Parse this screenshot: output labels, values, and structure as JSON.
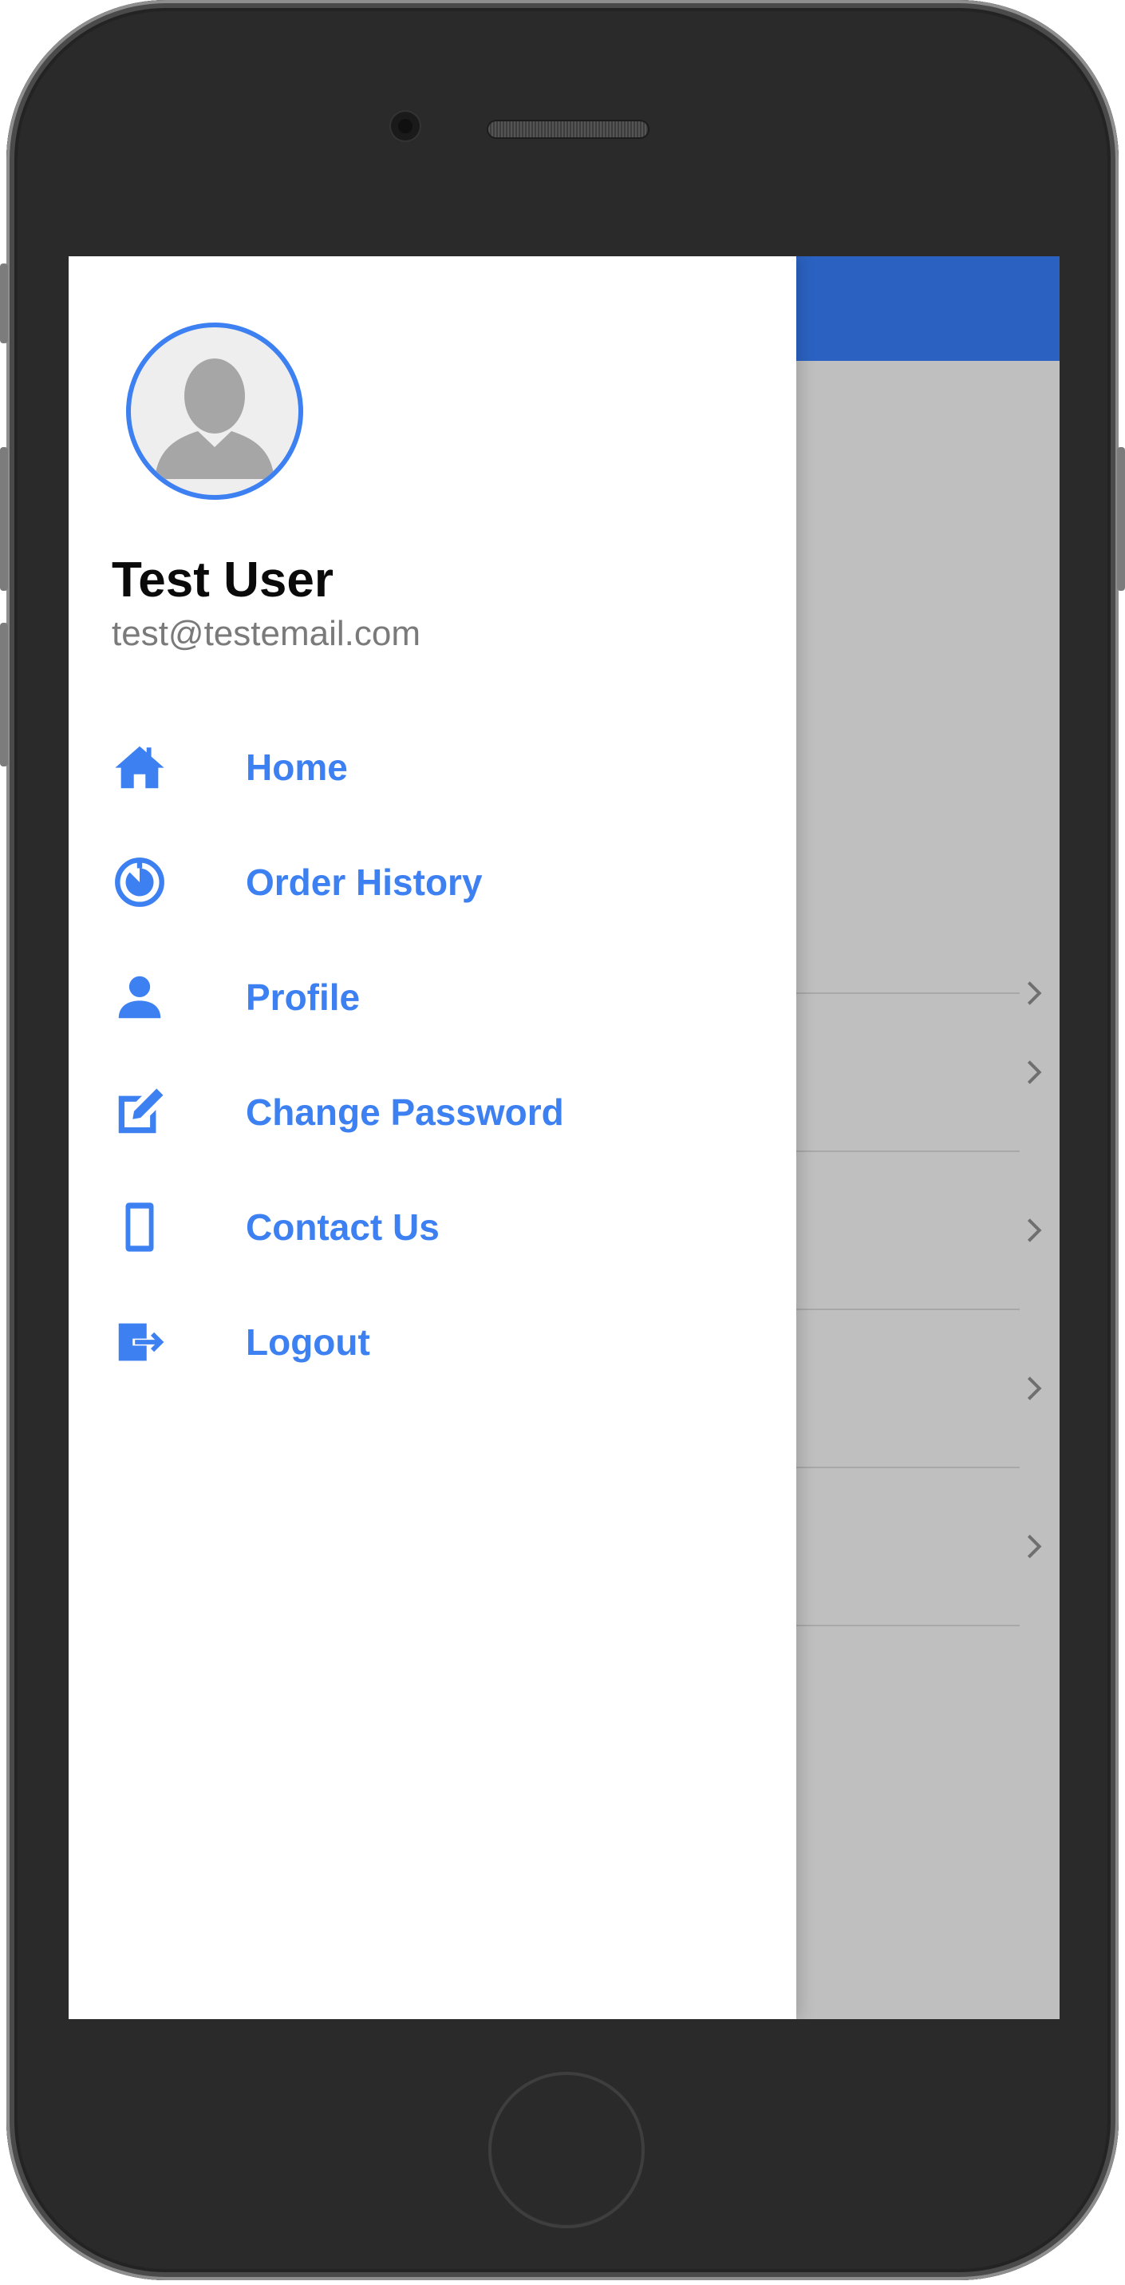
{
  "colors": {
    "accent": "#3d80f2",
    "app_bar": "#2b62c2",
    "scrim": "#bfbfbf",
    "user_name": "#0a0a0a",
    "email": "#7a7a7a"
  },
  "drawer": {
    "user": {
      "name": "Test User",
      "email": "test@testemail.com",
      "avatar_icon": "person-silhouette-icon"
    },
    "menu": [
      {
        "label": "Home",
        "icon": "home-icon"
      },
      {
        "label": "Order History",
        "icon": "timer-icon"
      },
      {
        "label": "Profile",
        "icon": "person-icon"
      },
      {
        "label": "Change Password",
        "icon": "edit-icon"
      },
      {
        "label": "Contact Us",
        "icon": "phone-icon"
      },
      {
        "label": "Logout",
        "icon": "logout-icon"
      }
    ]
  },
  "background_list": {
    "rows": [
      {
        "icon": "chevron-right-icon"
      },
      {
        "icon": "chevron-right-icon"
      },
      {
        "icon": "chevron-right-icon"
      },
      {
        "icon": "chevron-right-icon"
      },
      {
        "icon": "chevron-right-icon"
      }
    ]
  }
}
